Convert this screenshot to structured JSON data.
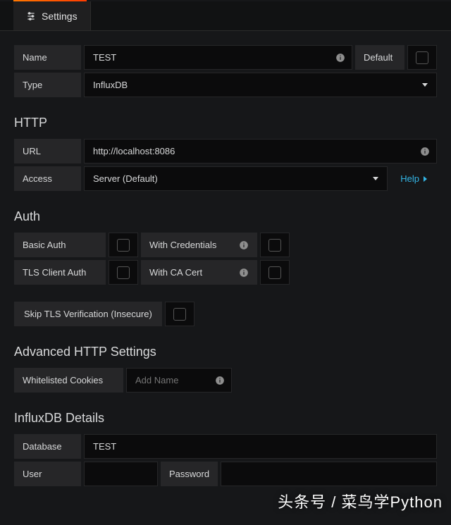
{
  "tab": {
    "label": "Settings"
  },
  "form": {
    "name": {
      "label": "Name",
      "value": "TEST"
    },
    "default_label": "Default",
    "type": {
      "label": "Type",
      "value": "InfluxDB"
    }
  },
  "http": {
    "title": "HTTP",
    "url": {
      "label": "URL",
      "value": "http://localhost:8086"
    },
    "access": {
      "label": "Access",
      "value": "Server (Default)"
    },
    "help": "Help"
  },
  "auth": {
    "title": "Auth",
    "basic": "Basic Auth",
    "with_credentials": "With Credentials",
    "tls_client": "TLS Client Auth",
    "with_ca": "With CA Cert",
    "skip_tls": "Skip TLS Verification (Insecure)"
  },
  "advanced": {
    "title": "Advanced HTTP Settings",
    "whitelist_label": "Whitelisted Cookies",
    "add_placeholder": "Add Name"
  },
  "influx": {
    "title": "InfluxDB Details",
    "database": {
      "label": "Database",
      "value": "TEST"
    },
    "user_label": "User",
    "password_label": "Password"
  },
  "watermark": "头条号 / 菜鸟学Python"
}
